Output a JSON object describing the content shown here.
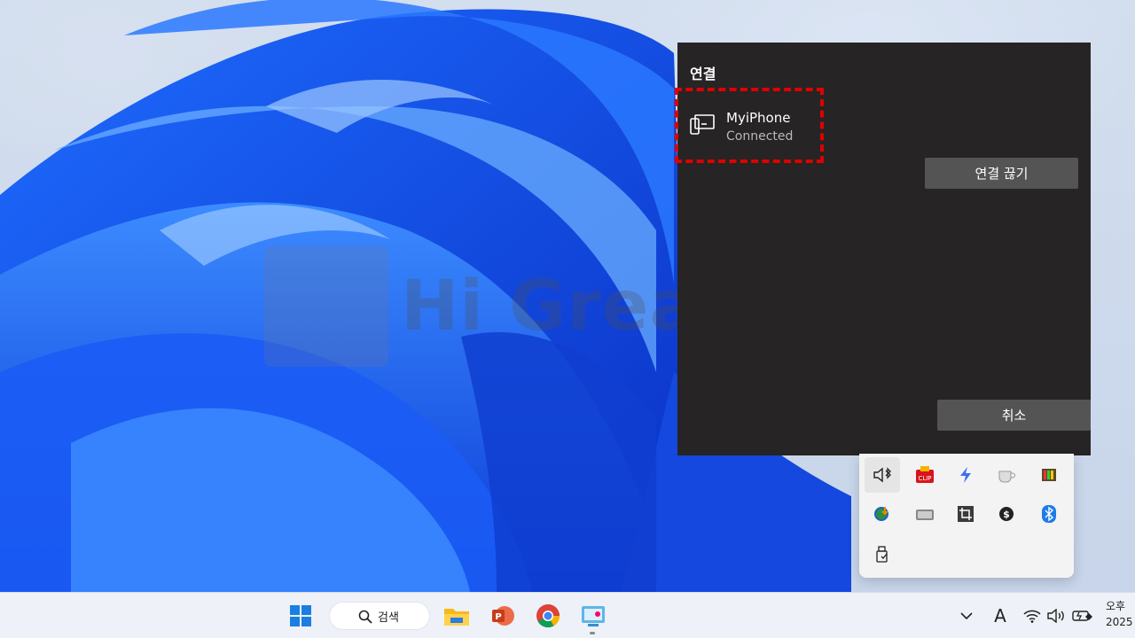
{
  "flyout": {
    "title": "연결",
    "device": {
      "name": "MyiPhone",
      "status": "Connected"
    },
    "disconnect_label": "연결 끊기",
    "cancel_label": "취소"
  },
  "watermark": {
    "text": "Hi Great King"
  },
  "tray": {
    "icons": [
      "speaker-bluetooth-icon",
      "clip-app-icon",
      "lightning-app-icon",
      "coffee-cup-icon",
      "palette-app-icon",
      "globe-download-icon",
      "keyboard-icon",
      "crop-tool-icon",
      "dollar-gear-icon",
      "bluetooth-icon",
      "usb-drive-icon"
    ]
  },
  "taskbar": {
    "search_label": "검색",
    "apps": [
      "windows-start-icon",
      "file-explorer-icon",
      "powerpoint-icon",
      "chrome-icon",
      "snipping-tool-icon"
    ],
    "system": {
      "chevron": "chevron-up-icon",
      "ime": "A",
      "clock_line1": "오후",
      "clock_line2": "2025"
    }
  },
  "colors": {
    "flyout_bg": "#262424",
    "button_bg": "#555454",
    "highlight": "#e00000",
    "taskbar_bg": "#eef1f7"
  }
}
